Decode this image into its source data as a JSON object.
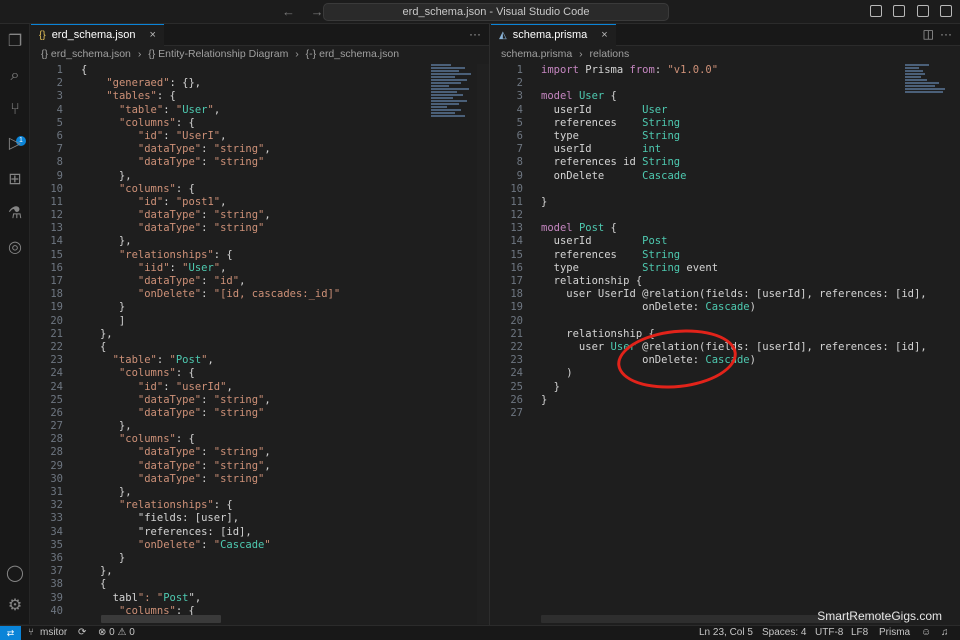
{
  "window": {
    "title": "erd_schema.json - Visual Studio Code",
    "nav_back": "←",
    "nav_forward": "→"
  },
  "left_editor": {
    "tab_label": "erd_schema.json",
    "tab_icon": "{}",
    "breadcrumb": [
      "{} erd_schema.json",
      "›",
      "{} Entity-Relationship Diagram",
      "›",
      "{-} erd_schema.json"
    ],
    "lines": [
      {
        "n": "1",
        "t": "{"
      },
      {
        "n": "2",
        "t": "    \"generaed\": {},"
      },
      {
        "n": "3",
        "t": "    \"tables\": {"
      },
      {
        "n": "4",
        "t": "      \"table\": \"User\","
      },
      {
        "n": "5",
        "t": "      \"columns\": {"
      },
      {
        "n": "6",
        "t": "         \"id\": \"UserI\","
      },
      {
        "n": "7",
        "t": "         \"dataType\": \"string\","
      },
      {
        "n": "8",
        "t": "         \"dataType\": \"string\""
      },
      {
        "n": "9",
        "t": "      },"
      },
      {
        "n": "10",
        "t": "      \"columns\": {"
      },
      {
        "n": "11",
        "t": "         \"id\": \"post1\","
      },
      {
        "n": "12",
        "t": "         \"dataType\": \"string\","
      },
      {
        "n": "13",
        "t": "         \"dataType\": \"string\""
      },
      {
        "n": "14",
        "t": "      },"
      },
      {
        "n": "15",
        "t": "      \"relationships\": {"
      },
      {
        "n": "16",
        "t": "         \"iid\": \"User\","
      },
      {
        "n": "17",
        "t": "         \"dataType\": \"id\","
      },
      {
        "n": "18",
        "t": "         \"onDelete\": \"[id, cascades:_id]\""
      },
      {
        "n": "19",
        "t": "      }"
      },
      {
        "n": "20",
        "t": "      ]"
      },
      {
        "n": "21",
        "t": "   },"
      },
      {
        "n": "22",
        "t": "   {"
      },
      {
        "n": "23",
        "t": "     \"table\": \"Post\","
      },
      {
        "n": "24",
        "t": "      \"columns\": {"
      },
      {
        "n": "24",
        "t": "         \"id\": \"userId\","
      },
      {
        "n": "25",
        "t": "         \"dataType\": \"string\","
      },
      {
        "n": "26",
        "t": "         \"dataType\": \"string\""
      },
      {
        "n": "27",
        "t": "      },"
      },
      {
        "n": "28",
        "t": "      \"columns\": {"
      },
      {
        "n": "28",
        "t": "         \"dataType\": \"string\","
      },
      {
        "n": "29",
        "t": "         \"dataType\": \"string\","
      },
      {
        "n": "30",
        "t": "         \"dataType\": \"string\""
      },
      {
        "n": "31",
        "t": "      },"
      },
      {
        "n": "32",
        "t": "      \"relationships\": {"
      },
      {
        "n": "33",
        "t": "         \"fields: [user],"
      },
      {
        "n": "34",
        "t": "         \"references: [id],"
      },
      {
        "n": "35",
        "t": "         \"onDelete\": \"Cascade\""
      },
      {
        "n": "36",
        "t": "      }"
      },
      {
        "n": "37",
        "t": "   },"
      },
      {
        "n": "38",
        "t": "   {"
      },
      {
        "n": "39",
        "t": "     tabl\": \"Post\","
      },
      {
        "n": "40",
        "t": "      \"columns\": {"
      }
    ]
  },
  "right_editor": {
    "tab_label": "schema.prisma",
    "breadcrumb": [
      "schema.prisma",
      "›",
      "relations"
    ],
    "lines": [
      {
        "n": "1",
        "t": "import Prisma from: \"v1.0.0\""
      },
      {
        "n": "2",
        "t": ""
      },
      {
        "n": "3",
        "t": "model User {"
      },
      {
        "n": "4",
        "t": "  userId        User"
      },
      {
        "n": "5",
        "t": "  references    String"
      },
      {
        "n": "6",
        "t": "  type          String"
      },
      {
        "n": "7",
        "t": "  userId        int"
      },
      {
        "n": "8",
        "t": "  references id String"
      },
      {
        "n": "9",
        "t": "  onDelete      Cascade"
      },
      {
        "n": "10",
        "t": ""
      },
      {
        "n": "11",
        "t": "}"
      },
      {
        "n": "12",
        "t": ""
      },
      {
        "n": "13",
        "t": "model Post {"
      },
      {
        "n": "14",
        "t": "  userId        Post"
      },
      {
        "n": "15",
        "t": "  references    String"
      },
      {
        "n": "16",
        "t": "  type          String event"
      },
      {
        "n": "17",
        "t": "  relationship {"
      },
      {
        "n": "18",
        "t": "    user UserId @relation(fields: [userId], references: [id],"
      },
      {
        "n": "19",
        "t": "                onDelete: Cascade)"
      },
      {
        "n": "20",
        "t": ""
      },
      {
        "n": "21",
        "t": "    relationship {"
      },
      {
        "n": "22",
        "t": "      user User @relation(fields: [userId], references: [id],"
      },
      {
        "n": "23",
        "t": "                onDelete: Cascade)"
      },
      {
        "n": "24",
        "t": "    )"
      },
      {
        "n": "25",
        "t": "  }"
      },
      {
        "n": "26",
        "t": "}"
      },
      {
        "n": "27",
        "t": ""
      }
    ]
  },
  "statusbar": {
    "branch": "msitor",
    "problems": "⊗ 0 ⚠ 0",
    "position": "Ln 23, Col 5",
    "spaces": "Spaces: 4",
    "encoding": "UTF-8",
    "eol": "LF8",
    "language": "Prisma"
  },
  "activity": {
    "badge_count": "1"
  },
  "watermark": "SmartRemoteGigs.com",
  "colors": {
    "accent": "#0a84d8",
    "annotation": "#e2231a",
    "keyword": "#c586c0",
    "string": "#ce9178",
    "property": "#9cdcfe",
    "type": "#4ec9b0"
  }
}
